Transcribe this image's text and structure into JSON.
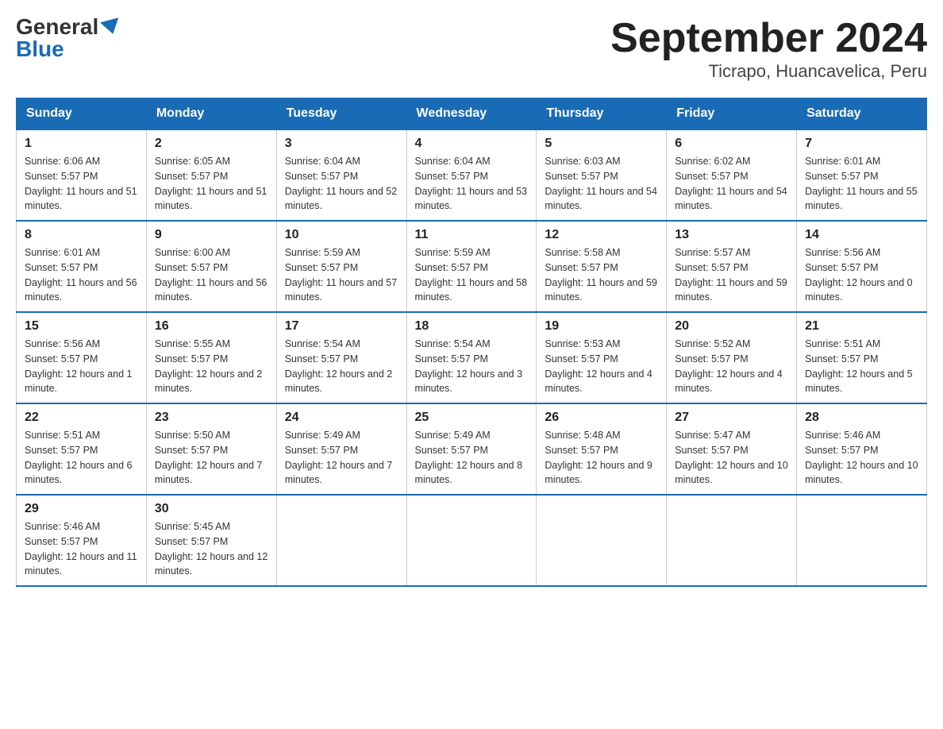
{
  "header": {
    "logo_general": "General",
    "logo_blue": "Blue",
    "month_year": "September 2024",
    "location": "Ticrapo, Huancavelica, Peru"
  },
  "weekdays": [
    "Sunday",
    "Monday",
    "Tuesday",
    "Wednesday",
    "Thursday",
    "Friday",
    "Saturday"
  ],
  "weeks": [
    [
      {
        "day": "1",
        "sunrise": "6:06 AM",
        "sunset": "5:57 PM",
        "daylight": "11 hours and 51 minutes."
      },
      {
        "day": "2",
        "sunrise": "6:05 AM",
        "sunset": "5:57 PM",
        "daylight": "11 hours and 51 minutes."
      },
      {
        "day": "3",
        "sunrise": "6:04 AM",
        "sunset": "5:57 PM",
        "daylight": "11 hours and 52 minutes."
      },
      {
        "day": "4",
        "sunrise": "6:04 AM",
        "sunset": "5:57 PM",
        "daylight": "11 hours and 53 minutes."
      },
      {
        "day": "5",
        "sunrise": "6:03 AM",
        "sunset": "5:57 PM",
        "daylight": "11 hours and 54 minutes."
      },
      {
        "day": "6",
        "sunrise": "6:02 AM",
        "sunset": "5:57 PM",
        "daylight": "11 hours and 54 minutes."
      },
      {
        "day": "7",
        "sunrise": "6:01 AM",
        "sunset": "5:57 PM",
        "daylight": "11 hours and 55 minutes."
      }
    ],
    [
      {
        "day": "8",
        "sunrise": "6:01 AM",
        "sunset": "5:57 PM",
        "daylight": "11 hours and 56 minutes."
      },
      {
        "day": "9",
        "sunrise": "6:00 AM",
        "sunset": "5:57 PM",
        "daylight": "11 hours and 56 minutes."
      },
      {
        "day": "10",
        "sunrise": "5:59 AM",
        "sunset": "5:57 PM",
        "daylight": "11 hours and 57 minutes."
      },
      {
        "day": "11",
        "sunrise": "5:59 AM",
        "sunset": "5:57 PM",
        "daylight": "11 hours and 58 minutes."
      },
      {
        "day": "12",
        "sunrise": "5:58 AM",
        "sunset": "5:57 PM",
        "daylight": "11 hours and 59 minutes."
      },
      {
        "day": "13",
        "sunrise": "5:57 AM",
        "sunset": "5:57 PM",
        "daylight": "11 hours and 59 minutes."
      },
      {
        "day": "14",
        "sunrise": "5:56 AM",
        "sunset": "5:57 PM",
        "daylight": "12 hours and 0 minutes."
      }
    ],
    [
      {
        "day": "15",
        "sunrise": "5:56 AM",
        "sunset": "5:57 PM",
        "daylight": "12 hours and 1 minute."
      },
      {
        "day": "16",
        "sunrise": "5:55 AM",
        "sunset": "5:57 PM",
        "daylight": "12 hours and 2 minutes."
      },
      {
        "day": "17",
        "sunrise": "5:54 AM",
        "sunset": "5:57 PM",
        "daylight": "12 hours and 2 minutes."
      },
      {
        "day": "18",
        "sunrise": "5:54 AM",
        "sunset": "5:57 PM",
        "daylight": "12 hours and 3 minutes."
      },
      {
        "day": "19",
        "sunrise": "5:53 AM",
        "sunset": "5:57 PM",
        "daylight": "12 hours and 4 minutes."
      },
      {
        "day": "20",
        "sunrise": "5:52 AM",
        "sunset": "5:57 PM",
        "daylight": "12 hours and 4 minutes."
      },
      {
        "day": "21",
        "sunrise": "5:51 AM",
        "sunset": "5:57 PM",
        "daylight": "12 hours and 5 minutes."
      }
    ],
    [
      {
        "day": "22",
        "sunrise": "5:51 AM",
        "sunset": "5:57 PM",
        "daylight": "12 hours and 6 minutes."
      },
      {
        "day": "23",
        "sunrise": "5:50 AM",
        "sunset": "5:57 PM",
        "daylight": "12 hours and 7 minutes."
      },
      {
        "day": "24",
        "sunrise": "5:49 AM",
        "sunset": "5:57 PM",
        "daylight": "12 hours and 7 minutes."
      },
      {
        "day": "25",
        "sunrise": "5:49 AM",
        "sunset": "5:57 PM",
        "daylight": "12 hours and 8 minutes."
      },
      {
        "day": "26",
        "sunrise": "5:48 AM",
        "sunset": "5:57 PM",
        "daylight": "12 hours and 9 minutes."
      },
      {
        "day": "27",
        "sunrise": "5:47 AM",
        "sunset": "5:57 PM",
        "daylight": "12 hours and 10 minutes."
      },
      {
        "day": "28",
        "sunrise": "5:46 AM",
        "sunset": "5:57 PM",
        "daylight": "12 hours and 10 minutes."
      }
    ],
    [
      {
        "day": "29",
        "sunrise": "5:46 AM",
        "sunset": "5:57 PM",
        "daylight": "12 hours and 11 minutes."
      },
      {
        "day": "30",
        "sunrise": "5:45 AM",
        "sunset": "5:57 PM",
        "daylight": "12 hours and 12 minutes."
      },
      null,
      null,
      null,
      null,
      null
    ]
  ],
  "labels": {
    "sunrise": "Sunrise:",
    "sunset": "Sunset:",
    "daylight": "Daylight:"
  }
}
